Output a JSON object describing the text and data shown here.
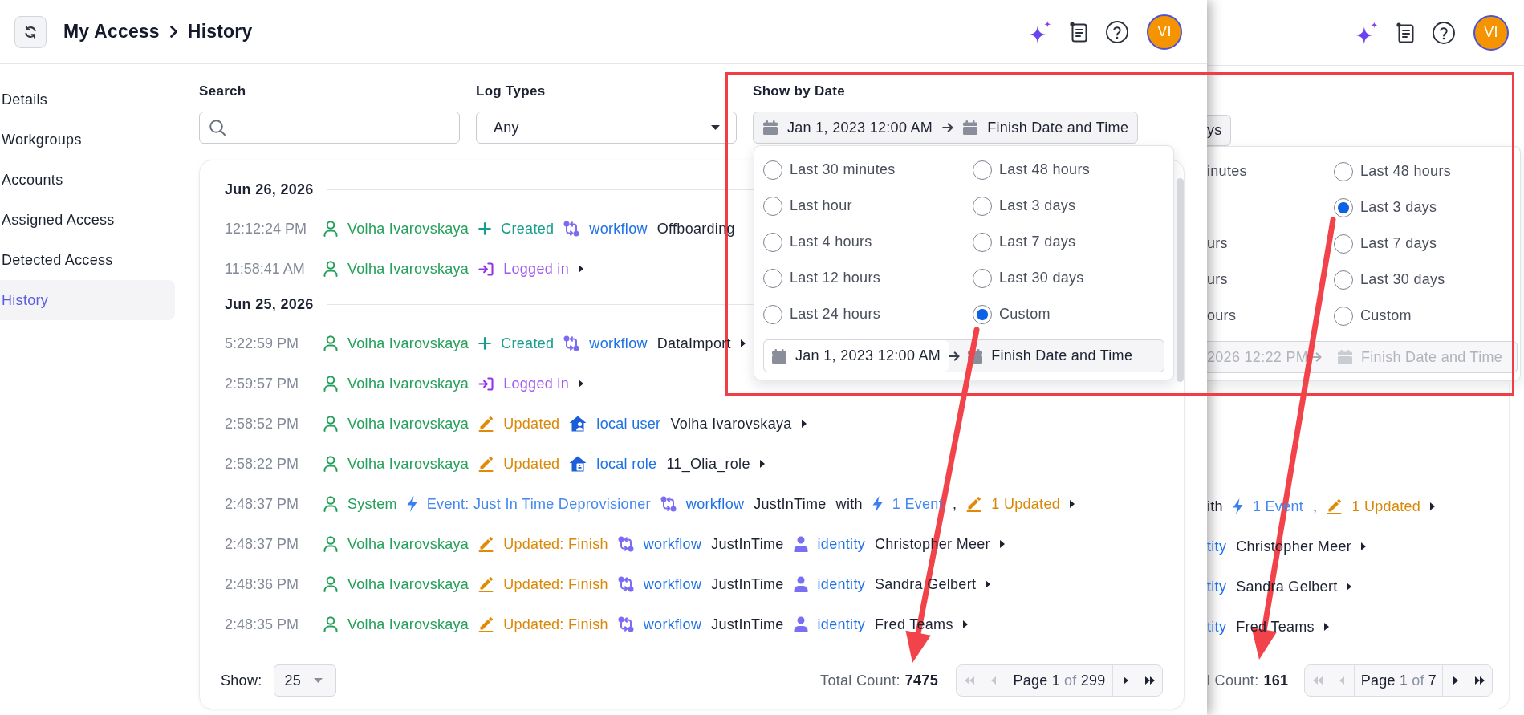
{
  "main_window": {
    "header": {
      "breadcrumb": [
        "My Access",
        "History"
      ],
      "avatar": "VI"
    },
    "sidebar": {
      "items": [
        {
          "label": "Details",
          "selected": false
        },
        {
          "label": "Workgroups",
          "selected": false
        },
        {
          "label": "Accounts",
          "selected": false
        },
        {
          "label": "Assigned Access",
          "selected": false
        },
        {
          "label": "Detected Access",
          "selected": false
        },
        {
          "label": "History",
          "selected": true
        }
      ]
    },
    "filters": {
      "search": {
        "label": "Search"
      },
      "log_types": {
        "label": "Log Types",
        "value": "Any"
      },
      "date": {
        "label": "Show by Date",
        "start": "Jan 1, 2023 12:00 AM",
        "end": "Finish Date and Time"
      }
    },
    "date_menu": {
      "columns": [
        {
          "options": [
            {
              "label": "Last 30 minutes",
              "selected": false
            },
            {
              "label": "Last hour",
              "selected": false
            },
            {
              "label": "Last 4 hours",
              "selected": false
            },
            {
              "label": "Last 12 hours",
              "selected": false
            },
            {
              "label": "Last 24 hours",
              "selected": false
            }
          ]
        },
        {
          "options": [
            {
              "label": "Last 48 hours",
              "selected": false
            },
            {
              "label": "Last 3 days",
              "selected": false
            },
            {
              "label": "Last 7 days",
              "selected": false
            },
            {
              "label": "Last 30 days",
              "selected": false
            },
            {
              "label": "Custom",
              "selected": true
            }
          ]
        }
      ],
      "custom_range": {
        "start": "Jan 1, 2023 12:00 AM",
        "end": "Finish Date and Time",
        "disabled": false
      }
    },
    "log": [
      {
        "date": "Jun 26, 2026",
        "entries": [
          {
            "time": "12:12:24 PM",
            "parts": [
              {
                "kind": "actor",
                "text": "Volha Ivarovskaya"
              },
              {
                "kind": "created",
                "text": "Created"
              },
              {
                "kind": "workflow",
                "text": "workflow"
              },
              {
                "kind": "name",
                "text": "Offboarding"
              }
            ],
            "expandable": false
          },
          {
            "time": "11:58:41 AM",
            "parts": [
              {
                "kind": "actor",
                "text": "Volha Ivarovskaya"
              },
              {
                "kind": "login",
                "text": "Logged in"
              }
            ],
            "expandable": true
          }
        ]
      },
      {
        "date": "Jun 25, 2026",
        "entries": [
          {
            "time": "5:22:59 PM",
            "parts": [
              {
                "kind": "actor",
                "text": "Volha Ivarovskaya"
              },
              {
                "kind": "created",
                "text": "Created"
              },
              {
                "kind": "workflow",
                "text": "workflow"
              },
              {
                "kind": "name",
                "text": "DataImport"
              }
            ],
            "expandable": true
          },
          {
            "time": "2:59:57 PM",
            "parts": [
              {
                "kind": "actor",
                "text": "Volha Ivarovskaya"
              },
              {
                "kind": "login",
                "text": "Logged in"
              }
            ],
            "expandable": true
          },
          {
            "time": "2:58:52 PM",
            "parts": [
              {
                "kind": "actor",
                "text": "Volha Ivarovskaya"
              },
              {
                "kind": "updated",
                "text": "Updated"
              },
              {
                "kind": "local_user",
                "text": "local user"
              },
              {
                "kind": "name",
                "text": "Volha Ivarovskaya"
              }
            ],
            "expandable": true
          },
          {
            "time": "2:58:22 PM",
            "parts": [
              {
                "kind": "actor",
                "text": "Volha Ivarovskaya"
              },
              {
                "kind": "updated",
                "text": "Updated"
              },
              {
                "kind": "local_role",
                "text": "local role"
              },
              {
                "kind": "name",
                "text": "11_Olia_role"
              }
            ],
            "expandable": true
          },
          {
            "time": "2:48:37 PM",
            "parts": [
              {
                "kind": "actor",
                "text": "System"
              },
              {
                "kind": "event",
                "text": "Event: Just In Time Deprovisioner"
              },
              {
                "kind": "workflow",
                "text": "workflow"
              },
              {
                "kind": "name",
                "text": "JustInTime"
              },
              {
                "kind": "text",
                "text": "with"
              },
              {
                "kind": "event",
                "text": "1 Event"
              },
              {
                "kind": "separator",
                "text": ","
              },
              {
                "kind": "updated",
                "text": "1 Updated"
              }
            ],
            "expandable": true
          },
          {
            "time": "2:48:37 PM",
            "parts": [
              {
                "kind": "actor",
                "text": "Volha Ivarovskaya"
              },
              {
                "kind": "updated",
                "text": "Updated: Finish"
              },
              {
                "kind": "workflow",
                "text": "workflow"
              },
              {
                "kind": "name",
                "text": "JustInTime"
              },
              {
                "kind": "identity",
                "text": "identity"
              },
              {
                "kind": "name",
                "text": "Christopher Meer"
              }
            ],
            "expandable": true
          },
          {
            "time": "2:48:36 PM",
            "parts": [
              {
                "kind": "actor",
                "text": "Volha Ivarovskaya"
              },
              {
                "kind": "updated",
                "text": "Updated: Finish"
              },
              {
                "kind": "workflow",
                "text": "workflow"
              },
              {
                "kind": "name",
                "text": "JustInTime"
              },
              {
                "kind": "identity",
                "text": "identity"
              },
              {
                "kind": "name",
                "text": "Sandra Gelbert"
              }
            ],
            "expandable": true
          },
          {
            "time": "2:48:35 PM",
            "parts": [
              {
                "kind": "actor",
                "text": "Volha Ivarovskaya"
              },
              {
                "kind": "updated",
                "text": "Updated: Finish"
              },
              {
                "kind": "workflow",
                "text": "workflow"
              },
              {
                "kind": "name",
                "text": "JustInTime"
              },
              {
                "kind": "identity",
                "text": "identity"
              },
              {
                "kind": "name",
                "text": "Fred Teams"
              }
            ],
            "expandable": true
          }
        ]
      }
    ],
    "footer": {
      "show_label": "Show:",
      "page_size": "25",
      "total_label": "Total Count:",
      "total": "7475",
      "pager": {
        "back_buttons": [
          {
            "kind": "first",
            "disabled": true
          },
          {
            "kind": "previous",
            "disabled": true
          }
        ],
        "page_word": "Page",
        "page": "1",
        "of_word": "of",
        "pages": "299",
        "forward_buttons": [
          {
            "kind": "next",
            "disabled": false
          },
          {
            "kind": "last",
            "disabled": false
          }
        ]
      }
    }
  },
  "background_window": {
    "header": {
      "avatar": "VI"
    },
    "date_button_fragment": "ys",
    "date_menu": {
      "rows": [
        {
          "left_fragment": "inutes",
          "label": "Last 48 hours",
          "selected": false
        },
        {
          "label": "Last 3 days",
          "selected": true
        },
        {
          "left_fragment": "urs",
          "label": "Last 7 days",
          "selected": false
        },
        {
          "left_fragment": "urs",
          "label": "Last 30 days",
          "selected": false
        },
        {
          "left_fragment": "ours",
          "label": "Custom",
          "selected": false
        }
      ],
      "custom_range": {
        "start": "2026 12:22 PM",
        "end": "Finish Date and Time",
        "disabled": true
      }
    },
    "entries": [
      {
        "parts": [
          {
            "kind": "text",
            "text": "ith"
          },
          {
            "kind": "event",
            "text": "1 Event"
          },
          {
            "kind": "separator",
            "text": ","
          },
          {
            "kind": "updated",
            "text": "1 Updated"
          }
        ],
        "expandable": true
      },
      {
        "parts": [
          {
            "kind": "type_cut",
            "text": "tity"
          },
          {
            "kind": "name",
            "text": "Christopher Meer"
          }
        ],
        "expandable": true
      },
      {
        "parts": [
          {
            "kind": "type_cut",
            "text": "tity"
          },
          {
            "kind": "name",
            "text": "Sandra Gelbert"
          }
        ],
        "expandable": true
      },
      {
        "parts": [
          {
            "kind": "type_cut",
            "text": "tity"
          },
          {
            "kind": "name",
            "text": "Fred Teams"
          }
        ],
        "expandable": true
      }
    ],
    "footer": {
      "total_label": "l Count:",
      "total": "161",
      "pager": {
        "back_buttons": [
          {
            "kind": "first",
            "disabled": true
          },
          {
            "kind": "previous",
            "disabled": true
          }
        ],
        "page_word": "Page",
        "page": "1",
        "of_word": "of",
        "pages": "7",
        "forward_buttons": [
          {
            "kind": "next",
            "disabled": false
          },
          {
            "kind": "last",
            "disabled": false
          }
        ]
      }
    }
  }
}
